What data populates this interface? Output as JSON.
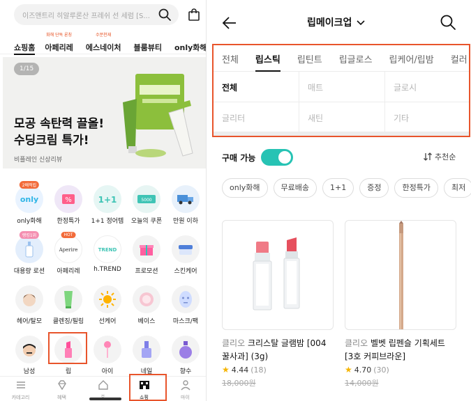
{
  "left": {
    "search_placeholder": "이즈앤트리 히알루론산 프레쉬 선 세럼 [S...",
    "nav_tabs": [
      {
        "label": "쇼핑홈",
        "sup": ""
      },
      {
        "label": "아페리레",
        "sup": "화해 단독 론칭"
      },
      {
        "label": "에스네이처",
        "sup": "수분천재"
      },
      {
        "label": "블룸뷰티",
        "sup": ""
      },
      {
        "label": "only화해",
        "sup": ""
      }
    ],
    "banner": {
      "pager": "1/15",
      "title_line1": "모공 속탄력 끌올!",
      "title_line2": "수딩크림 특가!",
      "sub": "비플레인 신상리뷰"
    },
    "grid": [
      {
        "label": "only화해",
        "badge": "2배적립",
        "icon": "only-logo-icon"
      },
      {
        "label": "한정특가",
        "badge": "",
        "icon": "percent-tag-icon"
      },
      {
        "label": "1+1 정어템",
        "badge": "",
        "icon": "one-plus-one-icon"
      },
      {
        "label": "오늘의 쿠폰",
        "badge": "",
        "icon": "coupon-icon"
      },
      {
        "label": "만원 이하",
        "badge": "",
        "icon": "delivery-truck-icon"
      },
      {
        "label": "대용량 로션",
        "badge": "랭킹1위",
        "icon": "lotion-icon"
      },
      {
        "label": "아페리레",
        "badge": "HOT",
        "icon": "aperire-logo-icon"
      },
      {
        "label": "h.TREND",
        "badge": "",
        "icon": "trend-logo-icon"
      },
      {
        "label": "프로모션",
        "badge": "",
        "icon": "gift-box-icon"
      },
      {
        "label": "스킨케어",
        "badge": "",
        "icon": "cream-jar-icon"
      },
      {
        "label": "헤어/탈모",
        "badge": "",
        "icon": "hair-icon"
      },
      {
        "label": "클렌징/필링",
        "badge": "",
        "icon": "cleansing-tube-icon"
      },
      {
        "label": "선케어",
        "badge": "",
        "icon": "sun-icon"
      },
      {
        "label": "베이스",
        "badge": "",
        "icon": "compact-icon"
      },
      {
        "label": "마스크/팩",
        "badge": "",
        "icon": "face-mask-icon"
      },
      {
        "label": "남성",
        "badge": "",
        "icon": "man-face-icon"
      },
      {
        "label": "립",
        "badge": "",
        "icon": "lipstick-icon"
      },
      {
        "label": "아이",
        "badge": "",
        "icon": "mascara-icon"
      },
      {
        "label": "네일",
        "badge": "",
        "icon": "nail-polish-icon"
      },
      {
        "label": "향수",
        "badge": "",
        "icon": "perfume-icon"
      }
    ],
    "bottom_nav": [
      {
        "label": "카테고리",
        "icon": "menu-icon"
      },
      {
        "label": "혜택",
        "icon": "diamond-icon"
      },
      {
        "label": "홈",
        "icon": "home-icon"
      },
      {
        "label": "쇼핑",
        "icon": "shop-icon"
      },
      {
        "label": "마이",
        "icon": "person-icon"
      }
    ]
  },
  "right": {
    "title": "립메이크업",
    "cat_tabs": [
      "전체",
      "립스틱",
      "립틴트",
      "립글로스",
      "립케어/립밤",
      "컬러"
    ],
    "active_tab": "립스틱",
    "sub_cats": [
      [
        "전체",
        "매트",
        "글로시"
      ],
      [
        "글리터",
        "새틴",
        "기타"
      ]
    ],
    "available_label": "구매 가능",
    "sort_label": "추천순",
    "chips": [
      "only화해",
      "무료배송",
      "1+1",
      "증정",
      "한정특가",
      "최저"
    ],
    "products": [
      {
        "brand": "클리오",
        "name": "크리스탈 글램밤 [004 꿀사과] (3g)",
        "rating": "4.44",
        "count": "(18)",
        "price": "18,000원"
      },
      {
        "brand": "클리오",
        "name": "벨벳 립펜슬 기획세트 [3호 커피브라운]",
        "rating": "4.70",
        "count": "(30)",
        "price": "14,000원"
      }
    ],
    "colors": {
      "accent_teal": "#27c3b4",
      "highlight_orange": "#e8542b"
    }
  }
}
